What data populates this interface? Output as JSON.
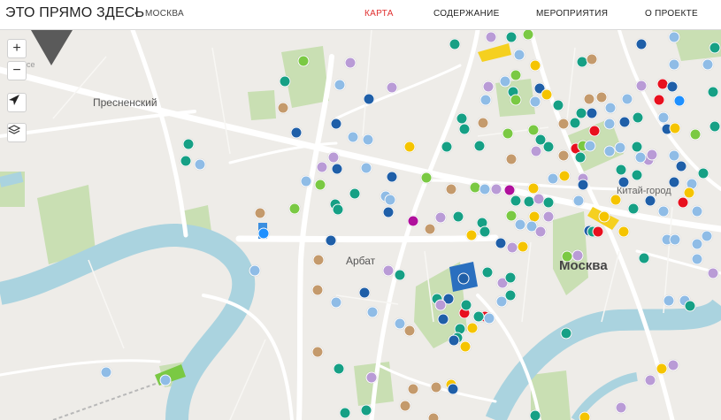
{
  "header": {
    "site_title": "ЭТО ПРЯМО ЗДЕСЬ",
    "separator": "•",
    "city": "МОСКВА",
    "nav": [
      {
        "label": "КАРТА",
        "active": true
      },
      {
        "label": "СОДЕРЖАНИЕ",
        "active": false
      },
      {
        "label": "МЕРОПРИЯТИЯ",
        "active": false
      },
      {
        "label": "О ПРОЕКТЕ",
        "active": false
      }
    ]
  },
  "map": {
    "controls": {
      "zoom_in": "+",
      "zoom_out": "−",
      "locate_icon": "navigation-arrow-icon",
      "layers_icon": "layers-icon"
    },
    "labels": {
      "presnensky": "Пресненский",
      "arbat": "Арбат",
      "kitay_gorod": "Китай-город",
      "moscow": "Москва",
      "corner_fragment": "се"
    },
    "colors": {
      "background": "#eeece8",
      "water": "#aad3df",
      "park": "#c9dfb3",
      "road": "#ffffff",
      "accent": "#e03030"
    },
    "marker_colors": {
      "light-blue": "#8fbce6",
      "blue": "#1f5fa8",
      "teal": "#16a085",
      "green": "#7ac943",
      "lilac": "#b99bd6",
      "brown": "#c49a6c",
      "yellow": "#f5c400",
      "red": "#e8101e",
      "magenta": "#b0109c",
      "azure": "#1e90ff"
    }
  }
}
